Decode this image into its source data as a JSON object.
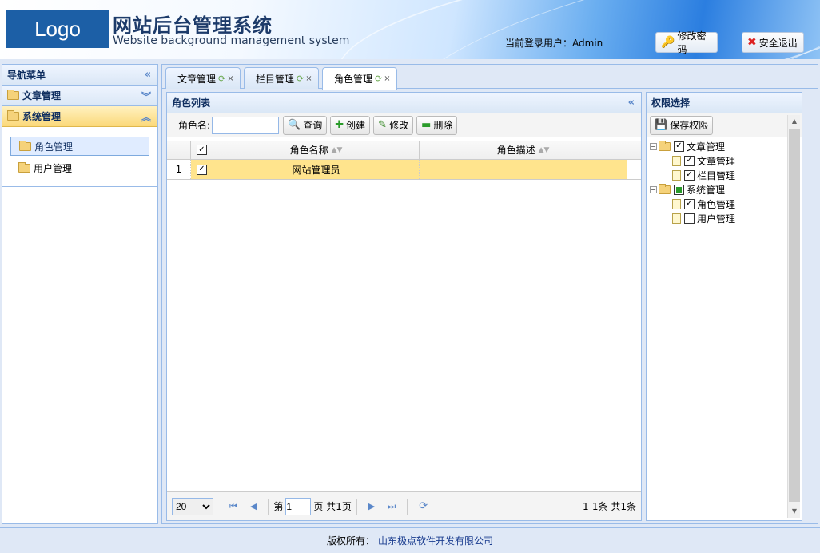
{
  "header": {
    "logo": "Logo",
    "title": "网站后台管理系统",
    "subtitle": "Website background management system",
    "current_user": "当前登录用户：Admin",
    "change_password": "修改密码",
    "logout": "安全退出"
  },
  "nav": {
    "title": "导航菜单",
    "sections": [
      {
        "label": "文章管理",
        "expanded": false
      },
      {
        "label": "系统管理",
        "expanded": true
      }
    ],
    "items": [
      {
        "label": "角色管理",
        "selected": true
      },
      {
        "label": "用户管理",
        "selected": false
      }
    ]
  },
  "tabs": [
    {
      "label": "文章管理",
      "active": false
    },
    {
      "label": "栏目管理",
      "active": false
    },
    {
      "label": "角色管理",
      "active": true
    }
  ],
  "role_list": {
    "title": "角色列表",
    "search_label": "角色名:",
    "search_value": "",
    "buttons": {
      "query": "查询",
      "create": "创建",
      "edit": "修改",
      "delete": "删除"
    },
    "columns": [
      "角色名称",
      "角色描述"
    ],
    "rows": [
      {
        "num": "1",
        "checked": true,
        "name": "网站管理员",
        "desc": ""
      }
    ],
    "pager": {
      "page_size": "20",
      "page_label": "第",
      "page_value": "1",
      "total_pages": "页 共1页",
      "summary": "1-1条 共1条"
    }
  },
  "permissions": {
    "title": "权限选择",
    "save_button": "保存权限",
    "tree": [
      {
        "label": "文章管理",
        "state": "checked",
        "children": [
          {
            "label": "文章管理",
            "checked": true
          },
          {
            "label": "栏目管理",
            "checked": true
          }
        ]
      },
      {
        "label": "系统管理",
        "state": "partial",
        "children": [
          {
            "label": "角色管理",
            "checked": true
          },
          {
            "label": "用户管理",
            "checked": false
          }
        ]
      }
    ]
  },
  "footer": {
    "label": "版权所有：",
    "company": "山东极点软件开发有限公司"
  },
  "colors": {
    "accent": "#99bbe8",
    "selected_row": "#ffe48d",
    "logo_bg": "#1c5fa6"
  }
}
